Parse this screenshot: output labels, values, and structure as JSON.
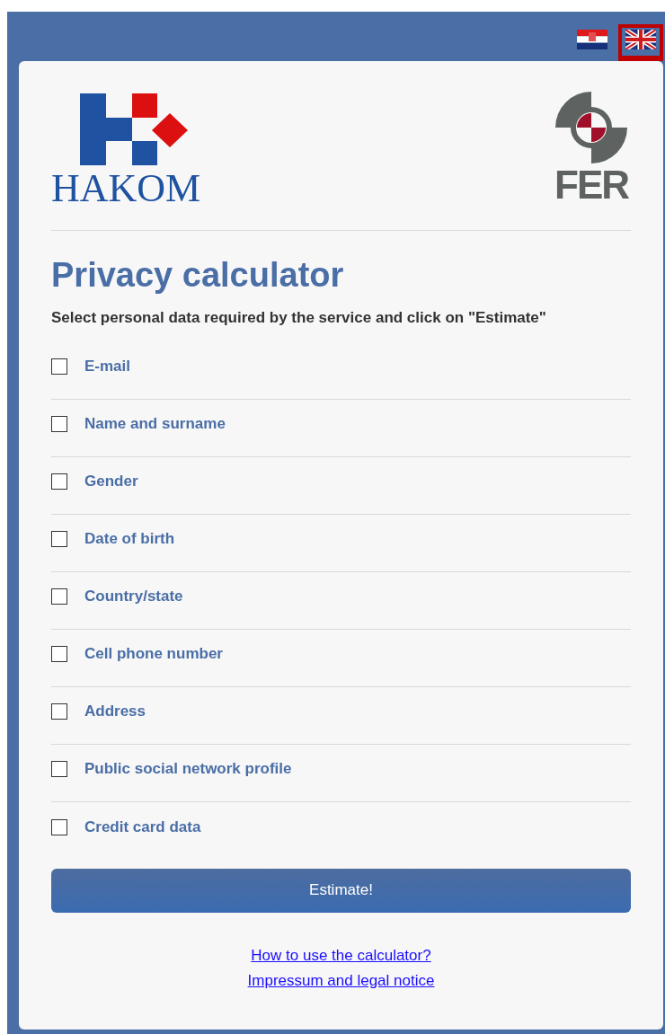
{
  "languages": [
    {
      "kind": "hr",
      "selected": false
    },
    {
      "kind": "en",
      "selected": true
    }
  ],
  "logos": {
    "left": "HAKOM",
    "right": "FER"
  },
  "title": "Privacy calculator",
  "instruction": "Select personal data required by the service and click on \"Estimate\"",
  "options": [
    {
      "label": "E-mail",
      "checked": false
    },
    {
      "label": "Name and surname",
      "checked": false
    },
    {
      "label": "Gender",
      "checked": false
    },
    {
      "label": "Date of birth",
      "checked": false
    },
    {
      "label": "Country/state",
      "checked": false
    },
    {
      "label": "Cell phone number",
      "checked": false
    },
    {
      "label": "Address",
      "checked": false
    },
    {
      "label": "Public social network profile",
      "checked": false
    },
    {
      "label": "Credit card data",
      "checked": false
    }
  ],
  "button": "Estimate!",
  "links": [
    "How to use the calculator?",
    "Impressum and legal notice"
  ]
}
